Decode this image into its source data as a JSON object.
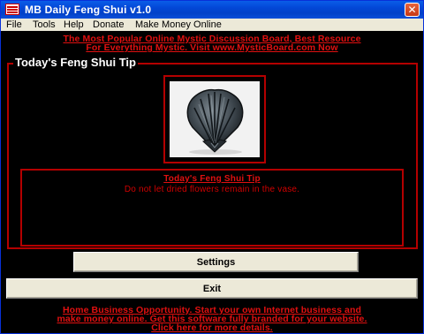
{
  "window": {
    "title": "MB Daily Feng Shui v1.0",
    "close_symbol": "✕"
  },
  "menu": {
    "items": [
      "File",
      "Tools",
      "Help",
      "Donate",
      "Make Money Online"
    ]
  },
  "top_banner": {
    "line1": "The Most Popular Online Mystic Discussion Board, Best Resource",
    "line2": "For Everything Mystic. Visit www.MysticBoard.com Now"
  },
  "tip_section": {
    "group_title": "Today's Feng Shui Tip",
    "image_icon": "scallop-shell-image",
    "heading": "Today's Feng Shui Tip",
    "text": "Do not let dried flowers remain in the vase."
  },
  "buttons": {
    "settings_label": "Settings",
    "exit_label": "Exit"
  },
  "bottom_banner": {
    "line1": "Home Business Opportunity. Start your own Internet business and",
    "line2": "make money online. Get this software fully branded for your website.",
    "line3": "Click here for more details."
  },
  "colors": {
    "accent_red": "#e01010",
    "border_red": "#b40000",
    "titlebar_blue": "#0347d6",
    "background": "#000000"
  }
}
